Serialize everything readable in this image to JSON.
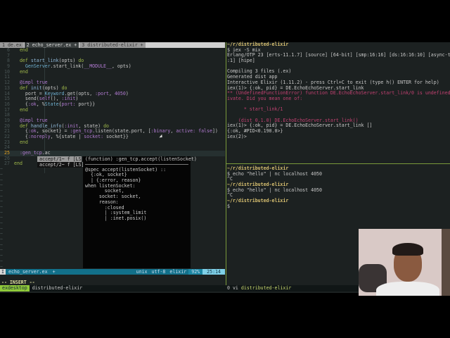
{
  "editor": {
    "tabs": [
      "1 de.ex",
      "2 echo_server.ex +",
      "3 distributed-elixir +"
    ],
    "lines": [
      {
        "n": "6",
        "tokens": [
          {
            "t": "  end",
            "c": "k"
          }
        ]
      },
      {
        "n": "7",
        "tokens": []
      },
      {
        "n": "8",
        "tokens": [
          {
            "t": "  def ",
            "c": "k"
          },
          {
            "t": "start_link",
            "c": "f"
          },
          {
            "t": "(opts) ",
            "c": "s"
          },
          {
            "t": "do",
            "c": "k"
          }
        ]
      },
      {
        "n": "9",
        "tokens": [
          {
            "t": "    GenServer",
            "c": "m"
          },
          {
            "t": ".start_link(",
            "c": "s"
          },
          {
            "t": "__MODULE__",
            "c": "a"
          },
          {
            "t": ", opts)",
            "c": "s"
          }
        ]
      },
      {
        "n": "10",
        "tokens": [
          {
            "t": "  end",
            "c": "k"
          }
        ]
      },
      {
        "n": "11",
        "tokens": []
      },
      {
        "n": "12",
        "tokens": [
          {
            "t": "  @impl ",
            "c": "a"
          },
          {
            "t": "true",
            "c": "a"
          }
        ]
      },
      {
        "n": "13",
        "tokens": [
          {
            "t": "  def ",
            "c": "k"
          },
          {
            "t": "init",
            "c": "f"
          },
          {
            "t": "(opts) ",
            "c": "s"
          },
          {
            "t": "do",
            "c": "k"
          }
        ]
      },
      {
        "n": "14",
        "tokens": [
          {
            "t": "    port = ",
            "c": "s"
          },
          {
            "t": "Keyword",
            "c": "m"
          },
          {
            "t": ".get(opts, ",
            "c": "s"
          },
          {
            "t": ":port",
            "c": "a"
          },
          {
            "t": ", ",
            "c": "s"
          },
          {
            "t": "4050",
            "c": "a"
          },
          {
            "t": ")",
            "c": "s"
          }
        ]
      },
      {
        "n": "15",
        "tokens": [
          {
            "t": "    send(",
            "c": "s"
          },
          {
            "t": "self",
            "c": "a"
          },
          {
            "t": "(), ",
            "c": "s"
          },
          {
            "t": ":init",
            "c": "a"
          },
          {
            "t": ")",
            "c": "s"
          }
        ]
      },
      {
        "n": "16",
        "tokens": [
          {
            "t": "    {",
            "c": "s"
          },
          {
            "t": ":ok",
            "c": "a"
          },
          {
            "t": ", %",
            "c": "s"
          },
          {
            "t": "State",
            "c": "m"
          },
          {
            "t": "{",
            "c": "s"
          },
          {
            "t": "port:",
            "c": "a"
          },
          {
            "t": " port}}",
            "c": "s"
          }
        ]
      },
      {
        "n": "17",
        "tokens": [
          {
            "t": "  end",
            "c": "k"
          }
        ]
      },
      {
        "n": "18",
        "tokens": []
      },
      {
        "n": "19",
        "tokens": [
          {
            "t": "  @impl ",
            "c": "a"
          },
          {
            "t": "true",
            "c": "a"
          }
        ]
      },
      {
        "n": "20",
        "tokens": [
          {
            "t": "  def ",
            "c": "k"
          },
          {
            "t": "handle_info",
            "c": "f"
          },
          {
            "t": "(",
            "c": "s"
          },
          {
            "t": ":init",
            "c": "a"
          },
          {
            "t": ", state) ",
            "c": "s"
          },
          {
            "t": "do",
            "c": "k"
          }
        ]
      },
      {
        "n": "21",
        "tokens": [
          {
            "t": "    {",
            "c": "s"
          },
          {
            "t": ":ok",
            "c": "a"
          },
          {
            "t": ", socket} = ",
            "c": "s"
          },
          {
            "t": ":gen_tcp",
            "c": "a"
          },
          {
            "t": ".listen(state.port, [",
            "c": "s"
          },
          {
            "t": ":binary",
            "c": "a"
          },
          {
            "t": ", ",
            "c": "s"
          },
          {
            "t": "active:",
            "c": "a"
          },
          {
            "t": " ",
            "c": "s"
          },
          {
            "t": "false",
            "c": "a"
          },
          {
            "t": "])",
            "c": "s"
          }
        ]
      },
      {
        "n": "22",
        "tokens": [
          {
            "t": "    {",
            "c": "s"
          },
          {
            "t": ":noreply",
            "c": "a"
          },
          {
            "t": ", %{state | ",
            "c": "s"
          },
          {
            "t": "socket:",
            "c": "a"
          },
          {
            "t": " socket}}",
            "c": "s"
          }
        ]
      },
      {
        "n": "23",
        "tokens": [
          {
            "t": "  end",
            "c": "k"
          }
        ]
      },
      {
        "n": "24",
        "tokens": []
      },
      {
        "n": "25",
        "current": true,
        "tokens": [
          {
            "t": "  :gen_tcp",
            "c": "a"
          },
          {
            "t": ".ac",
            "c": "s"
          }
        ]
      },
      {
        "n": "26",
        "tokens": []
      },
      {
        "n": "27",
        "tokens": [
          {
            "t": "end",
            "c": "k"
          }
        ]
      }
    ],
    "completion": {
      "items": [
        "accept/1~ f [LS]",
        "accept/2~ f [LS]"
      ],
      "doc_header": "(function) :gen_tcp.accept(listenSocket)",
      "doc_body": [
        "@spec accept(listenSocket) ::",
        "  {:ok, socket}",
        "  | {:error, reason}",
        "when listenSocket:",
        "       socket,",
        "     socket: socket,",
        "     reason:",
        "       :closed",
        "       | :system_limit",
        "       | :inet.posix()"
      ]
    },
    "statusline": {
      "mode": "I",
      "file": "echo_server.ex",
      "modified": "+",
      "format": "unix",
      "encoding": "utf-8",
      "filetype": "elixir",
      "percent": "92%",
      "position": "25:14"
    },
    "insert_label": "-- INSERT --"
  },
  "terminal_top": [
    {
      "t": "~/r/distributed-elixir",
      "c": "path"
    },
    {
      "t": "$ iex -S mix",
      "c": ""
    },
    {
      "t": "Erlang/OTP 23 [erts-11.1.7] [source] [64-bit] [smp:16:16] [ds:16:16:10] [async-threads",
      "c": ""
    },
    {
      "t": ":1] [hipe]",
      "c": ""
    },
    {
      "t": "",
      "c": ""
    },
    {
      "t": "Compiling 3 files (.ex)",
      "c": ""
    },
    {
      "t": "Generated dist app",
      "c": ""
    },
    {
      "t": "Interactive Elixir (1.11.2) - press Ctrl+C to exit (type h() ENTER for help)",
      "c": ""
    },
    {
      "t": "iex(1)> {:ok, pid} = DE.EchoEchoServer.start_link",
      "c": ""
    },
    {
      "t": "** (UndefinedFunctionError) function DE.EchoEchoServer.start_link/0 is undefined or pr",
      "c": "err"
    },
    {
      "t": "ivate. Did you mean one of:",
      "c": "err"
    },
    {
      "t": "",
      "c": ""
    },
    {
      "t": "      * start_link/1",
      "c": "err"
    },
    {
      "t": "",
      "c": ""
    },
    {
      "t": "    (dist 0.1.0) DE.EchoEchoServer.start_link()",
      "c": "err"
    },
    {
      "t": "iex(1)> {:ok, pid} = DE.EchoEchoServer.start_link []",
      "c": ""
    },
    {
      "t": "{:ok, #PID<0.190.0>}",
      "c": ""
    },
    {
      "t": "iex(2)>",
      "c": ""
    }
  ],
  "terminal_bottom": [
    {
      "t": "~/r/distributed-elixir",
      "c": "path"
    },
    {
      "t": "$ echo \"hello\" | nc localhost 4050",
      "c": ""
    },
    {
      "t": "^C",
      "c": ""
    },
    {
      "t": "~/r/distributed-elixir",
      "c": "path"
    },
    {
      "t": "$ echo \"hello\" | nc localhost 4050",
      "c": ""
    },
    {
      "t": "^C",
      "c": ""
    },
    {
      "t": "~/r/distributed-elixir",
      "c": "path"
    },
    {
      "t": "$",
      "c": ""
    }
  ],
  "tmux": {
    "session": "exdesktop",
    "window_name": "distributed-elixir",
    "right_index": "0 vi",
    "right_name": "distributed-elixir"
  }
}
